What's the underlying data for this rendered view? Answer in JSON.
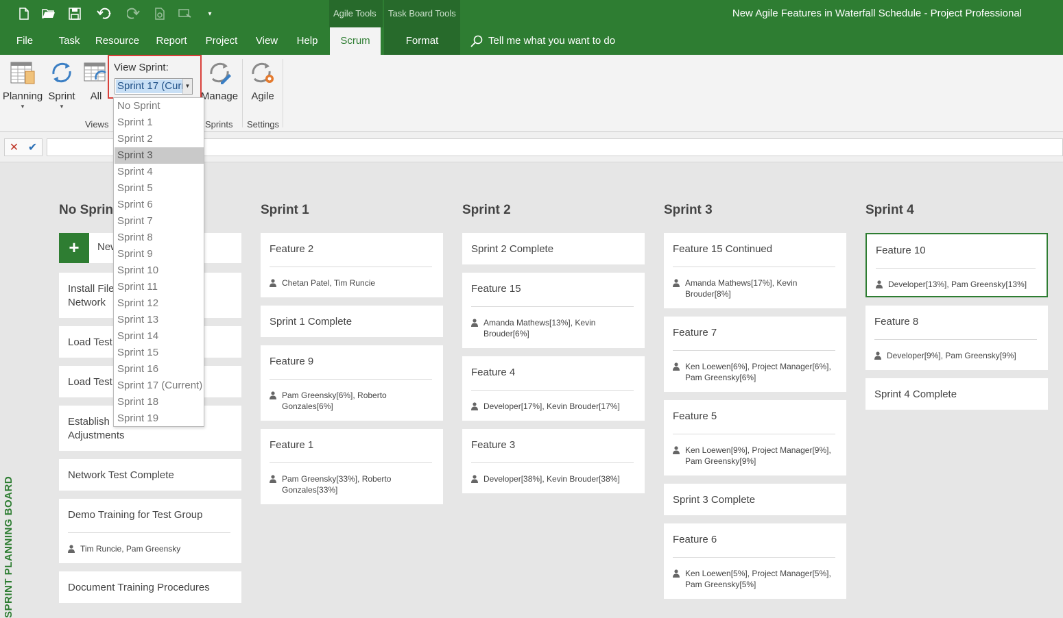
{
  "app": {
    "window_title": "New Agile Features in Waterfall Schedule  -  Project Professional",
    "context_tab_groups": [
      "Agile Tools",
      "Task Board Tools"
    ]
  },
  "quick_access": [
    "new-icon",
    "open-icon",
    "save-icon",
    "undo-icon",
    "redo-icon",
    "print-preview-icon",
    "task-mode-icon",
    "customize-icon"
  ],
  "tabs": [
    {
      "label": "File"
    },
    {
      "label": "Task"
    },
    {
      "label": "Resource"
    },
    {
      "label": "Report"
    },
    {
      "label": "Project"
    },
    {
      "label": "View"
    },
    {
      "label": "Help"
    },
    {
      "label": "Scrum",
      "active": true
    },
    {
      "label": "Format"
    }
  ],
  "tell_me": "Tell me what you want to do",
  "ribbon": {
    "buttons": {
      "planning": "Planning",
      "sprint": "Sprint",
      "all": "All",
      "manage": "Manage",
      "agile": "Agile"
    },
    "groups": {
      "views": "Views",
      "sprints": "Sprints",
      "settings": "Settings"
    },
    "view_sprint": {
      "label": "View Sprint:",
      "selected": "Sprint 17 (Current)"
    }
  },
  "dropdown": {
    "options": [
      "No Sprint",
      "Sprint 1",
      "Sprint 2",
      "Sprint 3",
      "Sprint 4",
      "Sprint 5",
      "Sprint 6",
      "Sprint 7",
      "Sprint 8",
      "Sprint 9",
      "Sprint 10",
      "Sprint 11",
      "Sprint 12",
      "Sprint 13",
      "Sprint 14",
      "Sprint 15",
      "Sprint 16",
      "Sprint 17 (Current)",
      "Sprint 18",
      "Sprint 19"
    ],
    "highlighted": "Sprint 3"
  },
  "board": {
    "side_label": "SPRINT PLANNING BOARD",
    "new_card_label": "New",
    "columns": [
      {
        "title": "No Sprint",
        "cards": [
          {
            "title": "Install File\nNetwork"
          },
          {
            "title": "Load Test"
          },
          {
            "title": "Load Test"
          },
          {
            "title": "Establish B\nAdjustments"
          },
          {
            "title": "Network Test Complete"
          },
          {
            "title": "Demo Training for Test Group",
            "resources": "Tim Runcie, Pam Greensky"
          },
          {
            "title": "Document Training Procedures"
          }
        ]
      },
      {
        "title": "Sprint 1",
        "cards": [
          {
            "title": "Feature 2",
            "resources": "Chetan Patel, Tim Runcie"
          },
          {
            "title": "Sprint 1 Complete"
          },
          {
            "title": "Feature 9",
            "resources": "Pam Greensky[6%], Roberto Gonzales[6%]"
          },
          {
            "title": "Feature 1",
            "resources": "Pam Greensky[33%], Roberto Gonzales[33%]"
          }
        ]
      },
      {
        "title": "Sprint 2",
        "cards": [
          {
            "title": "Sprint 2 Complete"
          },
          {
            "title": "Feature 15",
            "resources": "Amanda Mathews[13%], Kevin Brouder[6%]"
          },
          {
            "title": "Feature 4",
            "resources": "Developer[17%], Kevin Brouder[17%]"
          },
          {
            "title": "Feature 3",
            "resources": "Developer[38%], Kevin Brouder[38%]"
          }
        ]
      },
      {
        "title": "Sprint 3",
        "cards": [
          {
            "title": "Feature 15 Continued",
            "resources": "Amanda Mathews[17%], Kevin Brouder[8%]"
          },
          {
            "title": "Feature 7",
            "resources": "Ken Loewen[6%], Project Manager[6%], Pam Greensky[6%]"
          },
          {
            "title": "Feature 5",
            "resources": "Ken Loewen[9%], Project Manager[9%], Pam Greensky[9%]"
          },
          {
            "title": "Sprint 3 Complete"
          },
          {
            "title": "Feature 6",
            "resources": "Ken Loewen[5%], Project Manager[5%], Pam Greensky[5%]"
          }
        ]
      },
      {
        "title": "Sprint 4",
        "cards": [
          {
            "title": "Feature 10",
            "resources": "Developer[13%], Pam Greensky[13%]",
            "selected": true
          },
          {
            "title": "Feature 8",
            "resources": "Developer[9%], Pam Greensky[9%]"
          },
          {
            "title": "Sprint 4 Complete"
          }
        ]
      }
    ]
  },
  "colors": {
    "brand_green": "#2e7d32",
    "highlight_border": "#d9403a",
    "board_bg": "#e6e6e6"
  }
}
